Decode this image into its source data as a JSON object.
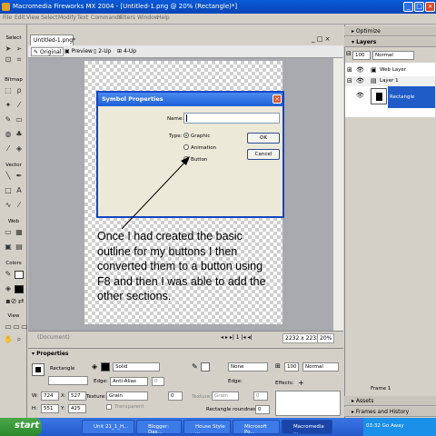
{
  "window": {
    "title": "Macromedia Fireworks MX 2004 - [Untitled-1.png @ 20% (Rectangle)*]",
    "controls": [
      "_",
      "□",
      "×"
    ]
  },
  "menu": [
    "File",
    "Edit",
    "View",
    "Select",
    "Modify",
    "Text",
    "Commands",
    "Filters",
    "Window",
    "Help"
  ],
  "tools": {
    "sections": [
      "Select",
      "Bitmap",
      "Vector",
      "Web",
      "Colors",
      "View"
    ]
  },
  "document": {
    "tab": "Untitled-1.png*",
    "view_tabs": [
      "Original",
      "Preview",
      "2-Up",
      "4-Up"
    ],
    "status_doc": "(Document)",
    "page": "1",
    "size": "2232 x 2232",
    "zoom": "20%"
  },
  "dialog": {
    "title": "Symbol Properties",
    "name_label": "Name:",
    "name_value": "",
    "type_label": "Type:",
    "types": [
      "Graphic",
      "Animation",
      "Button"
    ],
    "selected_type": "Graphic",
    "ok": "OK",
    "cancel": "Cancel"
  },
  "annotation": "Once I had created the basic outline for my buttons I then converted them to a button using F8 and then I was able to add the other sections.",
  "panels": {
    "optimize": "Optimize",
    "layers": "Layers",
    "opacity": "100",
    "blend": "Normal",
    "web_layer": "Web Layer",
    "layer1": "Layer 1",
    "object": "Rectangle",
    "frame": "Frame 1",
    "assets": "Assets",
    "frames_history": "Frames and History"
  },
  "properties": {
    "title": "Properties",
    "object": "Rectangle",
    "fill": "Solid",
    "edge_label": "Edge:",
    "edge": "Anti-Alias",
    "edge_val": "0",
    "texture_label": "Texture:",
    "texture": "Grain",
    "texture_val": "0",
    "transparent": "Transparent",
    "stroke": "None",
    "stroke_edge_label": "Edge:",
    "stroke_texture_label": "Texture:",
    "stroke_texture": "Grain",
    "stroke_texture_val": "0",
    "roundness_label": "Rectangle roundness:",
    "roundness": "0",
    "opacity": "100",
    "blend": "Normal",
    "effects_label": "Effects:",
    "w_label": "W:",
    "w": "724",
    "x_label": "X:",
    "x": "527",
    "h_label": "H:",
    "h": "551",
    "y_label": "Y:",
    "y": "425"
  },
  "taskbar": {
    "start": "start",
    "tasks": [
      "Unit 21_1_H...",
      "Blogger: Das...",
      "House Style ...",
      "Microsoft Po...",
      "Macromedia ..."
    ],
    "clock": "03:32 Go Away"
  }
}
